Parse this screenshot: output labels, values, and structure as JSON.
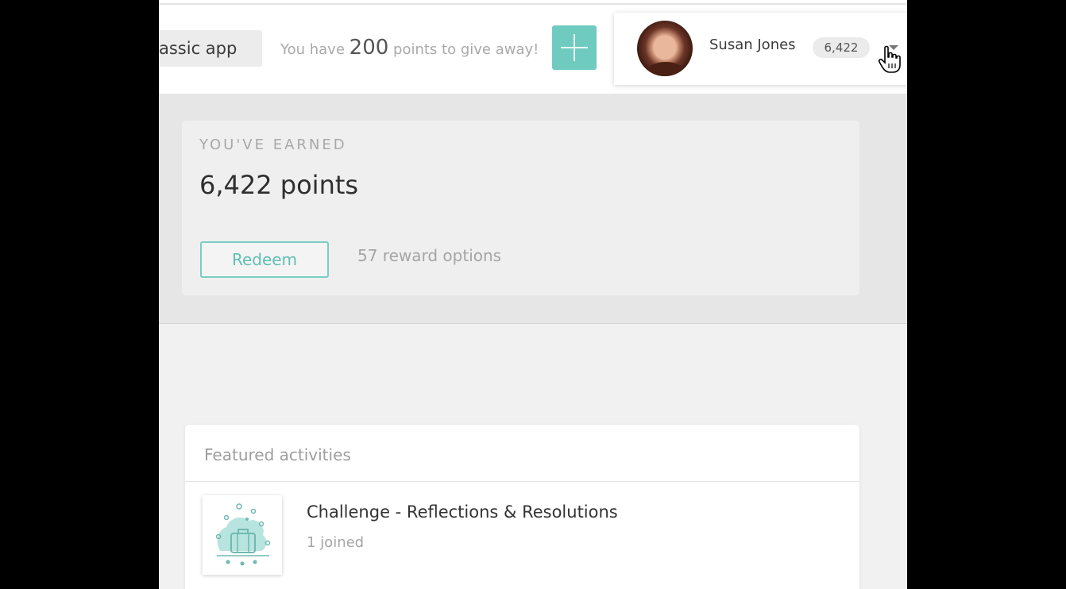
{
  "header": {
    "classic_app_label": "assic app",
    "give_prefix": "You have",
    "give_points": "200",
    "give_suffix": "points to give away!",
    "add_icon": "plus-icon"
  },
  "user": {
    "name": "Susan Jones",
    "points": "6,422",
    "menu_icon": "caret-down-icon"
  },
  "earned": {
    "label": "YOU'VE EARNED",
    "points_text": "6,422 points",
    "redeem_label": "Redeem",
    "reward_options": "57 reward options"
  },
  "featured": {
    "title": "Featured activities",
    "items": [
      {
        "title": "Challenge - Reflections & Resolutions",
        "subtitle": "1 joined",
        "icon": "suitcase-icon"
      }
    ]
  },
  "colors": {
    "accent": "#6fcbc0",
    "accent_text": "#5fbfb3"
  }
}
